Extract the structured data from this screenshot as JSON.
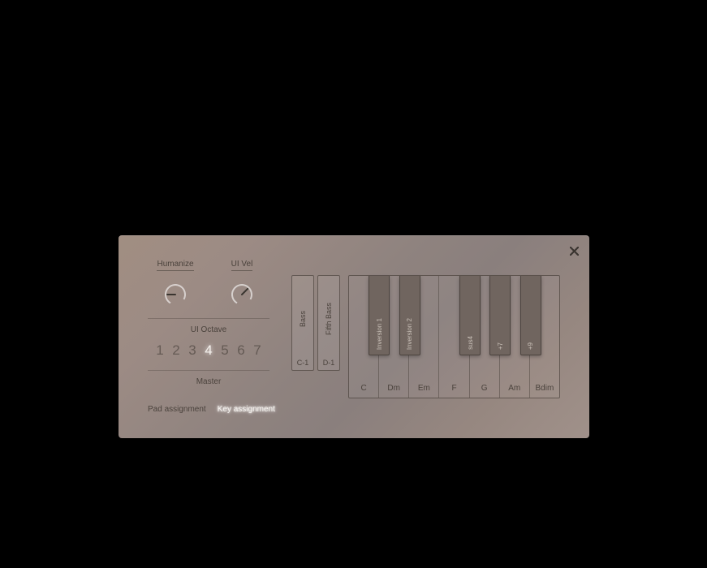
{
  "knobs": {
    "humanize": {
      "label": "Humanize",
      "angle": -90
    },
    "ui_vel": {
      "label": "UI Vel",
      "angle": 45
    }
  },
  "ui_octave": {
    "label": "UI Octave",
    "values": [
      "1",
      "2",
      "3",
      "4",
      "5",
      "6",
      "7"
    ],
    "selected": "4"
  },
  "master_label": "Master",
  "tabs": {
    "pad": "Pad assignment",
    "key": "Key assignment",
    "active": "key"
  },
  "bass_keys": [
    {
      "label": "Bass",
      "note": "C-1"
    },
    {
      "label": "Fifth Bass",
      "note": "D-1"
    }
  ],
  "piano": {
    "white": [
      "C",
      "Dm",
      "Em",
      "F",
      "G",
      "Am",
      "Bdim"
    ],
    "black": [
      {
        "pos": 0,
        "label": "Inversion 1"
      },
      {
        "pos": 1,
        "label": "Inversion 2"
      },
      {
        "pos": 3,
        "label": "sus4"
      },
      {
        "pos": 4,
        "label": "+7"
      },
      {
        "pos": 5,
        "label": "+9"
      }
    ]
  }
}
